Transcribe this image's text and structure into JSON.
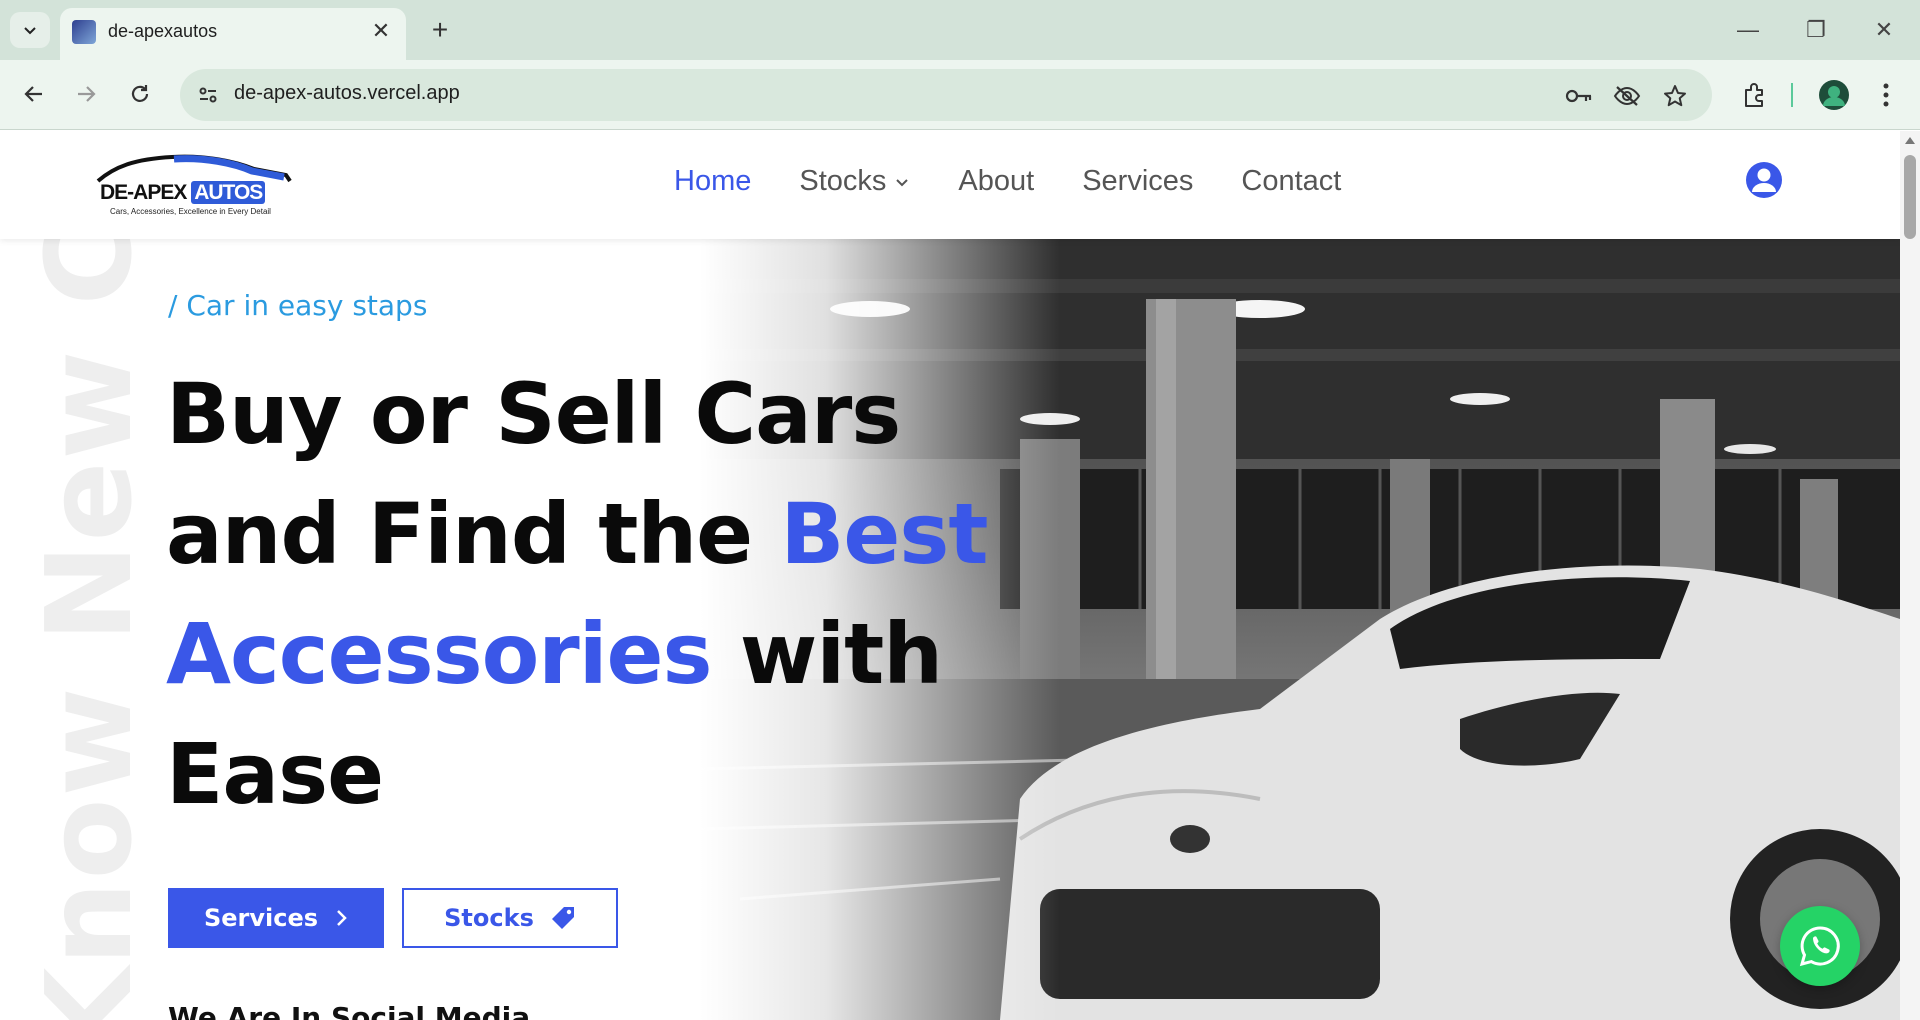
{
  "browser": {
    "tab_title": "de-apexautos",
    "close_glyph": "✕",
    "new_tab_glyph": "+",
    "url": "de-apex-autos.vercel.app",
    "minimize_glyph": "—",
    "restore_glyph": "❐",
    "close_window_glyph": "✕"
  },
  "site": {
    "logo_text_main": "DE-APEX ",
    "logo_text_accent": "AUTOS",
    "logo_tagline": "Cars, Accessories, Excellence in Every Detail",
    "nav": {
      "home": "Home",
      "stocks": "Stocks",
      "about": "About",
      "services": "Services",
      "contact": "Contact"
    }
  },
  "hero": {
    "vertical_text": "Know New Car",
    "eyebrow": "/ Car in easy staps",
    "headline_1": "Buy or Sell Cars",
    "headline_2": "and Find the ",
    "headline_highlight_1": "Best",
    "headline_highlight_2": "Accessories",
    "headline_3": " with",
    "headline_4": "Ease",
    "btn_services": "Services",
    "btn_stocks": "Stocks",
    "social_line": "We Are In Social Media"
  },
  "colors": {
    "accent": "#3a57e8",
    "eyebrow": "#2b9be0",
    "whatsapp": "#25d366"
  }
}
